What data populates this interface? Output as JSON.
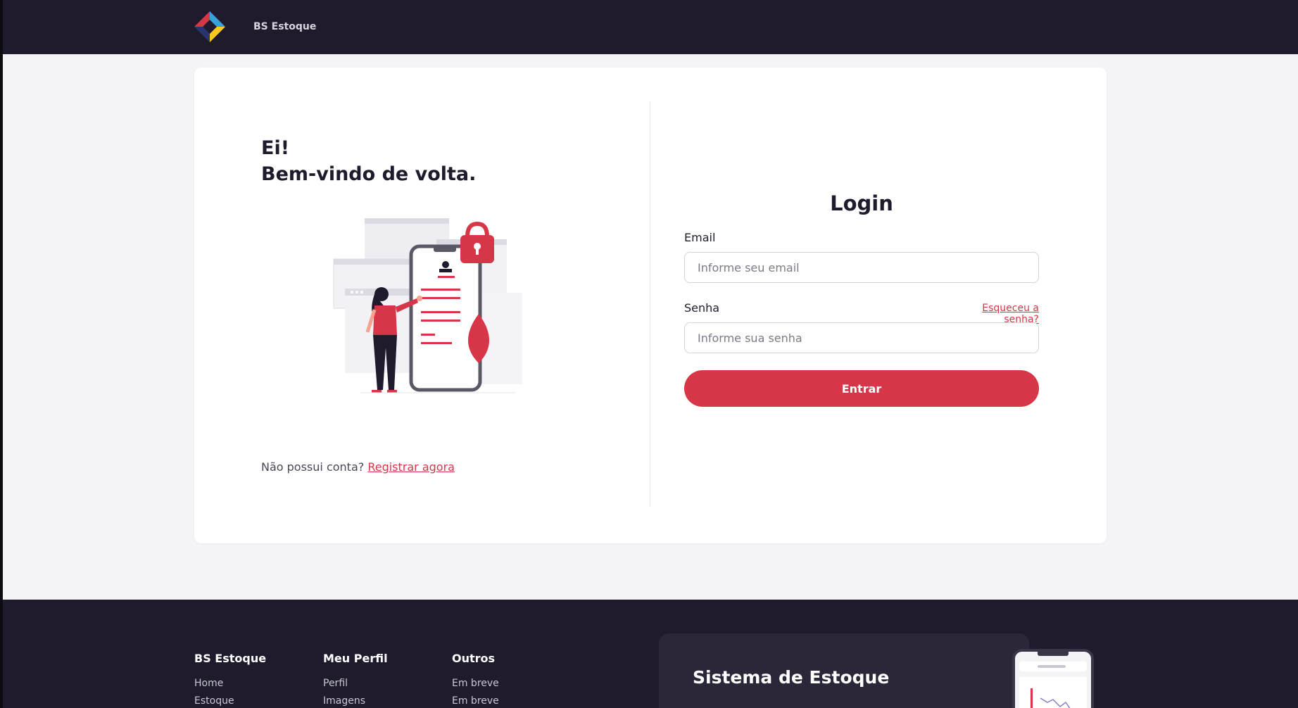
{
  "header": {
    "brand": "BS Estoque",
    "logo_colors": [
      "#d73649",
      "#3aa0dc",
      "#f6c71c",
      "#27356f"
    ]
  },
  "left_panel": {
    "greeting_line1": "Ei!",
    "greeting_line2": "Bem-vindo de volta.",
    "signup_prompt": "Não possui conta?",
    "signup_link": "Registrar agora"
  },
  "login": {
    "title": "Login",
    "email_label": "Email",
    "email_placeholder": "Informe seu email",
    "password_label": "Senha",
    "password_placeholder": "Informe sua senha",
    "forgot_link": "Esqueceu a senha?",
    "submit_label": "Entrar"
  },
  "footer": {
    "columns": [
      {
        "title": "BS Estoque",
        "links": [
          "Home",
          "Estoque"
        ]
      },
      {
        "title": "Meu Perfil",
        "links": [
          "Perfil",
          "Imagens"
        ]
      },
      {
        "title": "Outros",
        "links": [
          "Em breve",
          "Em breve"
        ]
      }
    ],
    "promo_title": "Sistema de Estoque"
  },
  "colors": {
    "accent": "#d73649",
    "dark": "#1f1b2d",
    "background": "#f4f4f7"
  }
}
